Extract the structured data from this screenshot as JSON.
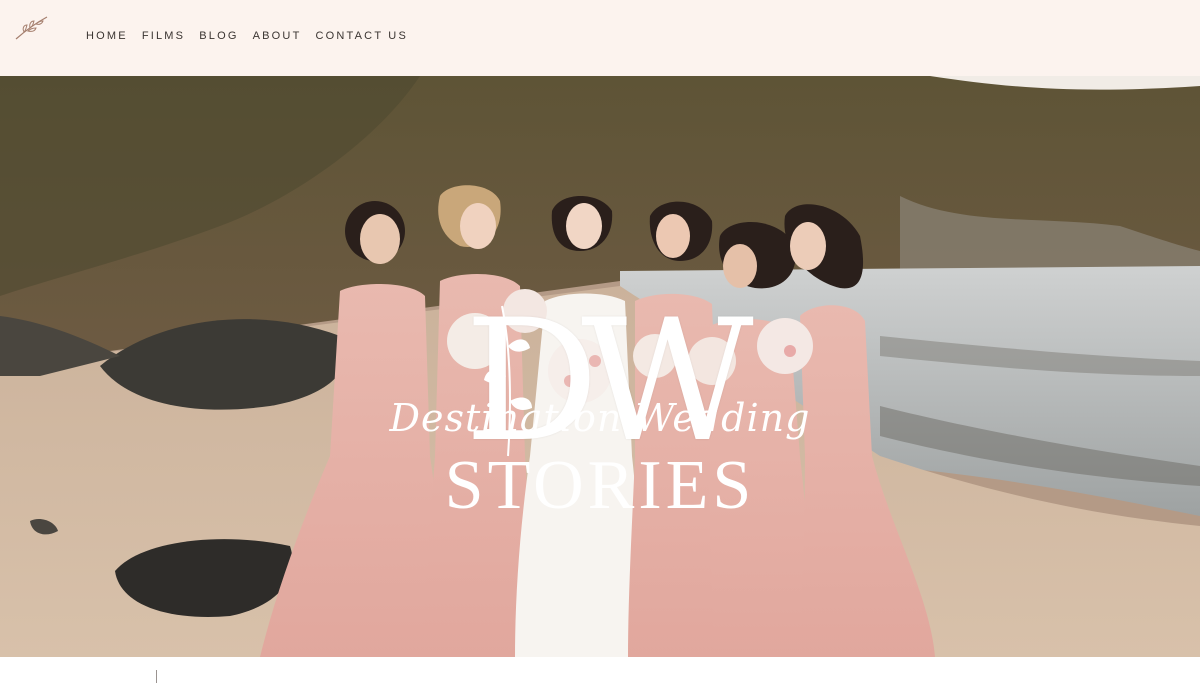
{
  "nav": {
    "items": [
      {
        "label": "HOME"
      },
      {
        "label": "FILMS"
      },
      {
        "label": "BLOG"
      },
      {
        "label": "ABOUT"
      },
      {
        "label": "CONTACT US"
      }
    ]
  },
  "hero": {
    "monogram": "DW",
    "tagline": "Destination Wedding",
    "title": "STORIES"
  },
  "colors": {
    "header_bg": "#fcf3ee",
    "nav_text": "#3a3431",
    "overlay_text": "#ffffff",
    "dress_pink": "#e3aea5"
  },
  "icons": {
    "logo": "leaf-sprig-icon"
  }
}
